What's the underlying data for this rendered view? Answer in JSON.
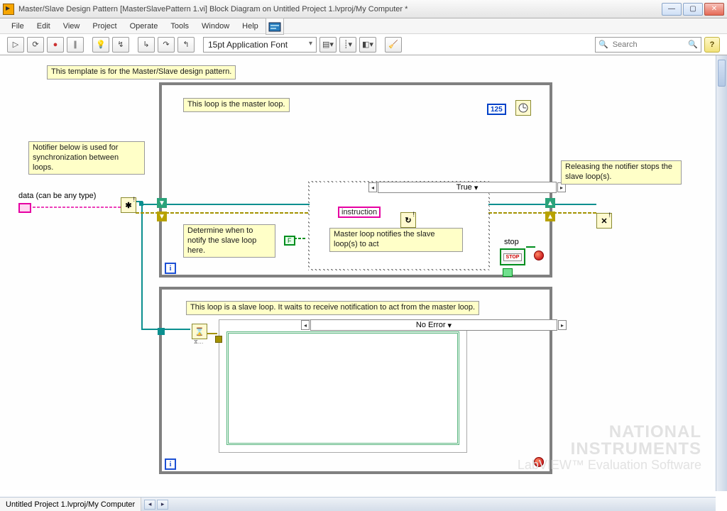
{
  "app": {
    "title": "Master/Slave Design Pattern [MasterSlavePattern 1.vi] Block Diagram on Untitled Project 1.lvproj/My Computer *"
  },
  "menu": [
    "File",
    "Edit",
    "View",
    "Project",
    "Operate",
    "Tools",
    "Window",
    "Help"
  ],
  "toolbar": {
    "font": "15pt Application Font",
    "search_placeholder": "Search"
  },
  "diagram": {
    "template_note": "This template is for the Master/Slave design pattern.",
    "notifier_note": "Notifier below is used for synchronization between loops.",
    "data_label": "data (can be any type)",
    "master_loop_note": "This loop is the master loop.",
    "determine_note": "Determine when to notify the slave loop here.",
    "master_notifies_note": "Master loop notifies the slave loop(s) to act",
    "instruction_label": "instruction",
    "case_true": "True",
    "stop_label": "stop",
    "stop_btn": "STOP",
    "release_note": "Releasing the notifier stops the slave loop(s).",
    "slave_loop_note": "This loop is a slave loop. It waits to receive notification to act from the master loop.",
    "case_noerror": "No Error",
    "wait_ms": "125",
    "false_const": "F"
  },
  "statusbar": {
    "path": "Untitled Project 1.lvproj/My Computer"
  },
  "watermark": {
    "line1": "NATIONAL",
    "line2": "INSTRUMENTS",
    "line3": "LabVIEW™ Evaluation Software"
  }
}
